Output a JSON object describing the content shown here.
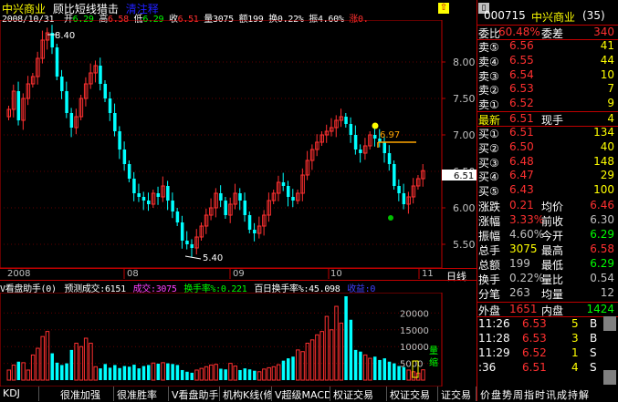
{
  "header": {
    "stock_name": "中兴商业",
    "indicator_name": "顾比短线猎击",
    "clear_button": "清注释",
    "date": "2008/10/31",
    "open_label": "开",
    "open": "6.29",
    "high_label": "高",
    "high": "6.58",
    "low_label": "低",
    "low": "6.29",
    "close_label": "收",
    "close": "6.51",
    "volume_label": "量",
    "volume": "3075",
    "amount_label": "额",
    "amount": "199",
    "turnover_label": "换",
    "turnover": "0.22%",
    "amplitude_label": "振",
    "amplitude": "4.60%",
    "change_label": "涨",
    "change": "0.",
    "peak_label": "8.40",
    "trough_label": "5.40",
    "price_marker": "6.97",
    "current_price_tag": "6.51"
  },
  "price_axis": [
    "8.00",
    "7.50",
    "7.00",
    "6.50",
    "6.00",
    "5.50"
  ],
  "time_axis": {
    "labels": [
      "2008",
      "08",
      "09",
      "10",
      "11"
    ],
    "period": "日线"
  },
  "volume_header": {
    "name": "V看盘助手(0)",
    "predict_label": "预测成交:",
    "predict": "6151",
    "volume_label": "成交:",
    "volume": "3075",
    "turnover_label": "换手率%:",
    "turnover": "0.221",
    "daily_label": "百日换手率%:",
    "daily": "45.098",
    "gain_label": "收益:",
    "gain": "0"
  },
  "volume_axis": [
    "20000",
    "15000",
    "10000",
    "5000"
  ],
  "volume_annotations": {
    "inflow": "量",
    "outflow": "缩"
  },
  "chart_data": [
    {
      "type": "candlestick",
      "title": "中兴商业 顾比短线猎击",
      "ylim": [
        5.3,
        8.5
      ],
      "x_labels": [
        "2008",
        "08",
        "09",
        "10",
        "11"
      ],
      "values_note": "daily close estimates",
      "series": [
        {
          "name": "close",
          "values": [
            7.35,
            7.6,
            7.2,
            7.5,
            7.7,
            7.8,
            8.05,
            8.3,
            8.4,
            8.2,
            7.8,
            7.6,
            7.3,
            7.1,
            7.25,
            7.5,
            7.7,
            7.85,
            7.95,
            7.7,
            7.5,
            7.3,
            7.05,
            6.8,
            6.6,
            6.4,
            6.2,
            6.15,
            6.1,
            6.05,
            6.2,
            6.15,
            6.3,
            6.1,
            5.95,
            5.8,
            5.55,
            5.5,
            5.45,
            5.6,
            5.75,
            5.9,
            6.0,
            6.2,
            6.1,
            5.9,
            6.05,
            6.2,
            6.1,
            5.9,
            5.7,
            5.65,
            5.75,
            5.9,
            6.1,
            6.2,
            6.35,
            6.3,
            6.15,
            6.1,
            6.2,
            6.45,
            6.65,
            6.8,
            6.9,
            7.0,
            7.05,
            7.1,
            7.2,
            7.25,
            7.15,
            7.0,
            6.8,
            6.75,
            6.85,
            7.0,
            6.95,
            6.9,
            6.75,
            6.6,
            6.3,
            6.2,
            6.05,
            6.15,
            6.3,
            6.4,
            6.51
          ]
        }
      ]
    },
    {
      "type": "bar",
      "title": "V看盘助手(0)",
      "ylim": [
        0,
        25000
      ],
      "series": [
        {
          "name": "成交",
          "values": [
            3000,
            4500,
            5500,
            5200,
            3000,
            7500,
            9500,
            13000,
            14500,
            8000,
            5200,
            4500,
            5000,
            9000,
            11000,
            10000,
            12500,
            11000,
            4000,
            3500,
            4800,
            3700,
            4500,
            3600,
            4200,
            4000,
            4600,
            3500,
            4200,
            4500,
            5100,
            4900,
            5200,
            5000,
            4800,
            4500,
            3000,
            2500,
            2200,
            3000,
            3500,
            4000,
            4500,
            4700,
            3400,
            3200,
            5000,
            4200,
            3000,
            3500,
            3200,
            2800,
            2500,
            3300,
            3700,
            4000,
            4600,
            5800,
            6500,
            7000,
            9000,
            8500,
            11000,
            12000,
            13500,
            14500,
            19000,
            15000,
            22000,
            17000,
            26000,
            18000,
            9000,
            8500,
            7500,
            6500,
            7000,
            6000,
            6500,
            5500,
            5000,
            4200,
            3900,
            3000,
            2500,
            2100,
            3075
          ]
        }
      ]
    }
  ],
  "right_panel": {
    "code": "000715",
    "name": "中兴商业",
    "count": "(35)",
    "ratio_label": "委比",
    "ratio": "60.48%",
    "diff_label": "委差",
    "diff": "340",
    "asks": [
      {
        "label": "卖⑤",
        "price": "6.56",
        "vol": "41"
      },
      {
        "label": "卖④",
        "price": "6.55",
        "vol": "44"
      },
      {
        "label": "卖③",
        "price": "6.54",
        "vol": "10"
      },
      {
        "label": "卖②",
        "price": "6.53",
        "vol": "7"
      },
      {
        "label": "卖①",
        "price": "6.52",
        "vol": "9"
      }
    ],
    "last_label": "最新",
    "last": "6.51",
    "hand_label": "现手",
    "hand": "4",
    "bids": [
      {
        "label": "买①",
        "price": "6.51",
        "vol": "134"
      },
      {
        "label": "买②",
        "price": "6.50",
        "vol": "40"
      },
      {
        "label": "买③",
        "price": "6.48",
        "vol": "148"
      },
      {
        "label": "买④",
        "price": "6.47",
        "vol": "29"
      },
      {
        "label": "买⑤",
        "price": "6.43",
        "vol": "100"
      }
    ],
    "stats": [
      {
        "l1": "涨跌",
        "v1": "0.21",
        "l2": "均价",
        "v2": "6.46",
        "c1": "red",
        "c2": "red"
      },
      {
        "l1": "涨幅",
        "v1": "3.33%",
        "l2": "前收",
        "v2": "6.30",
        "c1": "red",
        "c2": "gray"
      },
      {
        "l1": "振幅",
        "v1": "4.60%",
        "l2": "今开",
        "v2": "6.29",
        "c1": "gray",
        "c2": "green"
      },
      {
        "l1": "总手",
        "v1": "3075",
        "l2": "最高",
        "v2": "6.58",
        "c1": "yellow",
        "c2": "red"
      },
      {
        "l1": "总额",
        "v1": "199",
        "l2": "最低",
        "v2": "6.29",
        "c1": "gray",
        "c2": "green"
      },
      {
        "l1": "换手",
        "v1": "0.22%",
        "l2": "量比",
        "v2": "0.54",
        "c1": "gray",
        "c2": "gray"
      },
      {
        "l1": "分笔",
        "v1": "263",
        "l2": "均量",
        "v2": "12",
        "c1": "gray",
        "c2": "gray"
      }
    ],
    "outer_label": "外盘",
    "outer": "1651",
    "inner_label": "内盘",
    "inner": "1424",
    "ticks": [
      {
        "time": "11:26",
        "price": "6.53",
        "vol": "5",
        "side": "B"
      },
      {
        "time": "11:28",
        "price": "6.53",
        "vol": "3",
        "side": "B"
      },
      {
        "time": "11:29",
        "price": "6.52",
        "vol": "1",
        "side": "S"
      },
      {
        "time": ":36",
        "price": "6.51",
        "vol": "4",
        "side": "S"
      }
    ],
    "side_tabs": "价盘势周指时讯成持解",
    "counter": "1.00"
  },
  "bottom_tabs": [
    "KDJ",
    "很准加强",
    "很准胜率",
    "V看盘助手",
    "机构K线(修",
    "V超级MACD",
    "权证交易",
    "权证交易",
    "证交易"
  ],
  "colors": {
    "up": "#ff3030",
    "down": "#00ffff",
    "grid": "#800000",
    "axis": "#c00000",
    "background": "#000000"
  }
}
